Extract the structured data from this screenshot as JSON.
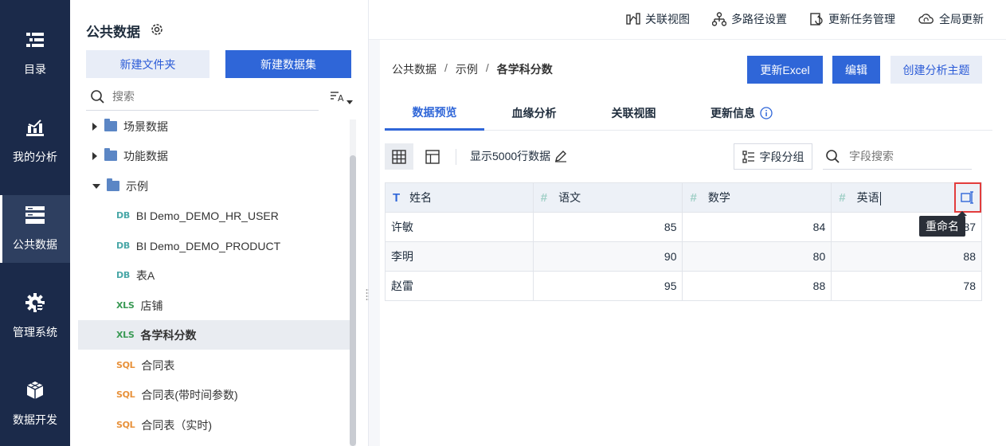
{
  "nav": {
    "items": [
      {
        "label": "目录",
        "icon": "catalog-icon"
      },
      {
        "label": "我的分析",
        "icon": "analysis-icon"
      },
      {
        "label": "公共数据",
        "icon": "public-data-icon",
        "active": true
      },
      {
        "label": "管理系统",
        "icon": "admin-gear-icon"
      },
      {
        "label": "数据开发",
        "icon": "data-dev-cube-icon"
      }
    ]
  },
  "tree": {
    "title": "公共数据",
    "new_folder": "新建文件夹",
    "new_dataset": "新建数据集",
    "search_placeholder": "搜索",
    "items": [
      {
        "label": "场景数据",
        "type": "folder",
        "expanded": false
      },
      {
        "label": "功能数据",
        "type": "folder",
        "expanded": false
      },
      {
        "label": "示例",
        "type": "folder",
        "expanded": true
      },
      {
        "label": "BI Demo_DEMO_HR_USER",
        "type": "db",
        "tag": "DB"
      },
      {
        "label": "BI Demo_DEMO_PRODUCT",
        "type": "db",
        "tag": "DB"
      },
      {
        "label": "表A",
        "type": "db",
        "tag": "DB"
      },
      {
        "label": "店铺",
        "type": "xls",
        "tag": "XLS"
      },
      {
        "label": "各学科分数",
        "type": "xls",
        "tag": "XLS",
        "selected": true
      },
      {
        "label": "合同表",
        "type": "sql",
        "tag": "SQL"
      },
      {
        "label": "合同表(带时间参数)",
        "type": "sql",
        "tag": "SQL"
      },
      {
        "label": "合同表（实时)",
        "type": "sql",
        "tag": "SQL"
      }
    ]
  },
  "topbar": {
    "related_view": "关联视图",
    "multi_path": "多路径设置",
    "task_mgmt": "更新任务管理",
    "global_update": "全局更新"
  },
  "breadcrumb": [
    "公共数据",
    "示例",
    "各学科分数"
  ],
  "breadcrumb_sep": "/",
  "actions": {
    "update_excel": "更新Excel",
    "edit": "编辑",
    "create_topic": "创建分析主题"
  },
  "tabs": [
    "数据预览",
    "血缘分析",
    "关联视图",
    "更新信息"
  ],
  "toolbar": {
    "show_rows": "显示5000行数据",
    "field_group": "字段分组",
    "field_search_placeholder": "字段搜索"
  },
  "table": {
    "columns": [
      {
        "name": "姓名",
        "type": "text",
        "icon": "T"
      },
      {
        "name": "语文",
        "type": "number",
        "icon": "#"
      },
      {
        "name": "数学",
        "type": "number",
        "icon": "#"
      },
      {
        "name": "英语",
        "type": "number",
        "icon": "#"
      }
    ],
    "rows": [
      [
        "许敏",
        "85",
        "84",
        "87"
      ],
      [
        "李明",
        "90",
        "80",
        "88"
      ],
      [
        "赵雷",
        "95",
        "88",
        "78"
      ]
    ]
  },
  "tooltip": "重命名",
  "colors": {
    "nav_bg": "#1b2a4a",
    "primary": "#2f66d8",
    "highlight_border": "#e23c3c"
  }
}
